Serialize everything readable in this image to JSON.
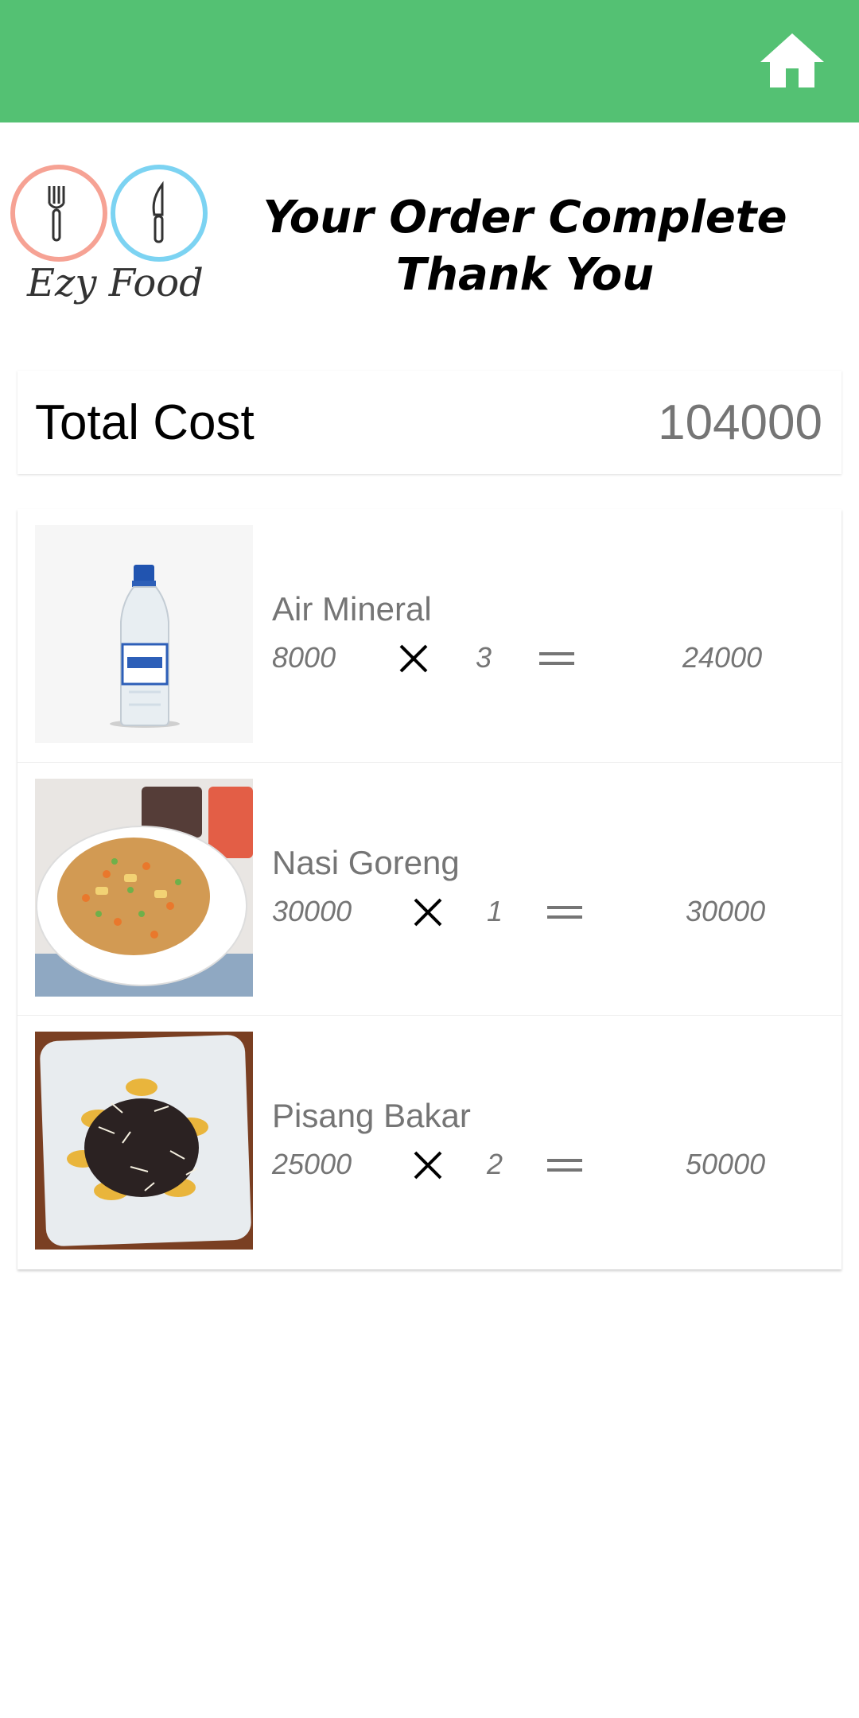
{
  "header": {
    "home_icon": "home-icon",
    "background_color": "#54C173"
  },
  "logo": {
    "text": "Ezy Food",
    "icons": [
      "fork-icon",
      "knife-icon"
    ]
  },
  "message": {
    "line1": "Your Order Complete",
    "line2": "Thank You"
  },
  "total": {
    "label": "Total Cost",
    "value": "104000"
  },
  "items": [
    {
      "name": "Air Mineral",
      "price": "8000",
      "qty": "3",
      "subtotal": "24000",
      "image": "water-bottle-image"
    },
    {
      "name": "Nasi Goreng",
      "price": "30000",
      "qty": "1",
      "subtotal": "30000",
      "image": "fried-rice-image"
    },
    {
      "name": "Pisang Bakar",
      "price": "25000",
      "qty": "2",
      "subtotal": "50000",
      "image": "grilled-banana-image"
    }
  ],
  "operators": {
    "multiply_icon": "multiply-icon",
    "equals_icon": "equals-icon"
  }
}
